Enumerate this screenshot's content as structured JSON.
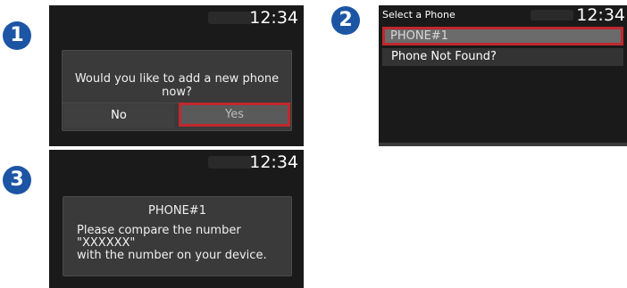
{
  "page": {
    "top_strip_text": ""
  },
  "step1": {
    "badge": "1",
    "clock": "12:34",
    "dialog_message": "Would you like to add a new phone now?",
    "no_label": "No",
    "yes_label": "Yes"
  },
  "step2": {
    "badge": "2",
    "header_title": "Select a Phone",
    "clock": "12:34",
    "items": [
      {
        "label": "PHONE#1",
        "selected": true
      },
      {
        "label": "Phone Not Found?",
        "selected": false
      }
    ]
  },
  "step3": {
    "badge": "3",
    "clock": "12:34",
    "device_name": "PHONE#1",
    "message_line1": "Please compare the number",
    "message_line2": "\"XXXXXX\"",
    "message_line3": "with the number on your device."
  },
  "colors": {
    "badge_blue": "#1d55a5",
    "screen_bg": "#1a1a1a",
    "selection_red": "#c0282d",
    "yes_button_bg": "#5a5a5a",
    "selected_item_bg": "#6b6b6b"
  }
}
